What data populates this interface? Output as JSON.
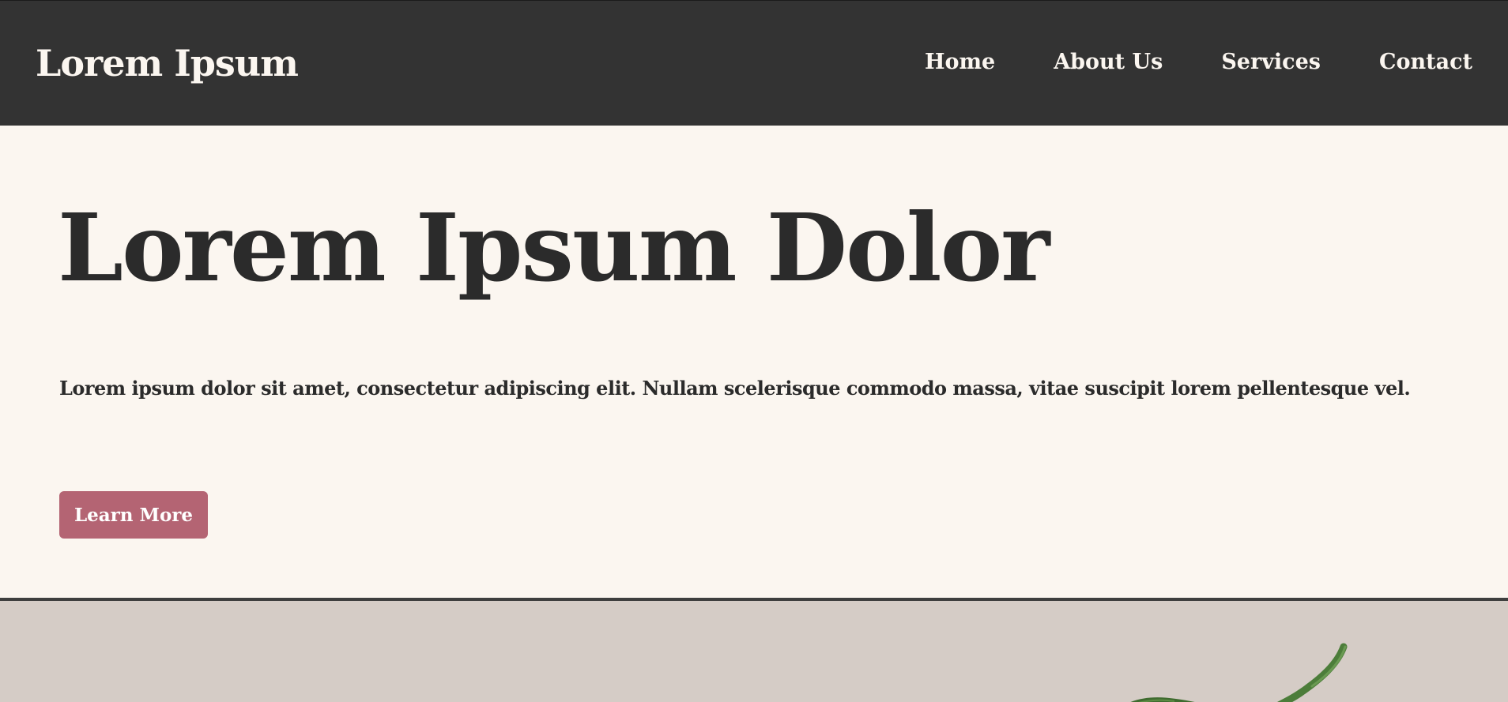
{
  "header": {
    "brand": "Lorem Ipsum",
    "nav": [
      {
        "label": "Home"
      },
      {
        "label": "About Us"
      },
      {
        "label": "Services"
      },
      {
        "label": "Contact"
      }
    ]
  },
  "hero": {
    "title": "Lorem Ipsum Dolor",
    "text": "Lorem ipsum dolor sit amet, consectetur adipiscing elit. Nullam scelerisque commodo massa, vitae suscipit lorem pellentesque vel.",
    "button_label": "Learn More"
  },
  "colors": {
    "header_bg": "#333333",
    "page_bg": "#fbf6f0",
    "accent": "#b46473",
    "image_band_bg": "#d5ccc6",
    "text_dark": "#2b2b2b"
  },
  "icons": {
    "plant": "plant-image"
  }
}
